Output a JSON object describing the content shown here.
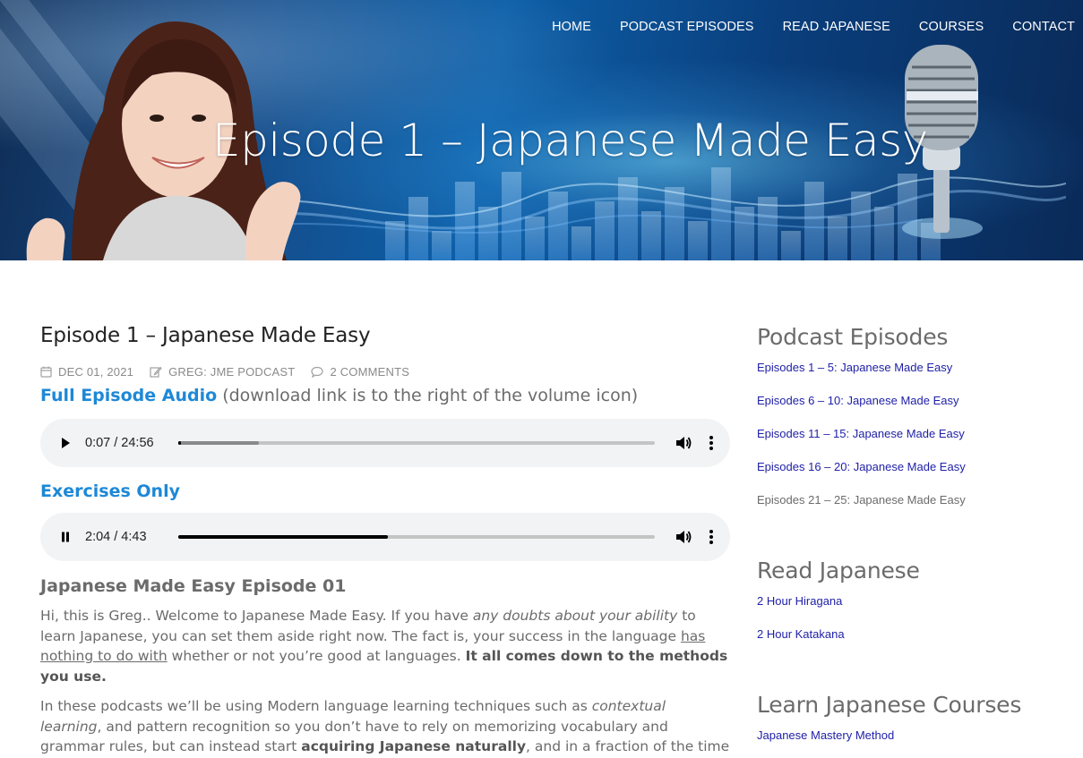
{
  "nav": {
    "items": [
      "HOME",
      "PODCAST EPISODES",
      "READ JAPANESE",
      "COURSES",
      "CONTACT"
    ]
  },
  "hero": {
    "title": "Episode 1 – Japanese Made Easy"
  },
  "post": {
    "title": "Episode 1 – Japanese Made Easy",
    "date": "DEC 01, 2021",
    "author": "GREG: JME PODCAST",
    "comments": "2 COMMENTS",
    "full_audio_heading": "Full Episode Audio",
    "full_audio_note": "(download link is to the right of the volume icon)",
    "exercises_heading": "Exercises Only",
    "episode_heading": "Japanese Made Easy Episode 01"
  },
  "players": [
    {
      "state": "paused",
      "time": "0:07 / 24:56",
      "progress": 0.005,
      "buffered": 0.17
    },
    {
      "state": "playing",
      "time": "2:04 / 4:43",
      "progress": 0.44,
      "buffered": 0.44
    }
  ],
  "paragraph1": {
    "t1": "Hi, this is Greg.. Welcome to Japanese Made Easy. If you have ",
    "i1": "any doubts about your ability",
    "t2": " to learn Japanese, you can set them aside right now. The fact is, your success in the language ",
    "u1": "has nothing to do with",
    "t3": " whether or not you’re good at languages. ",
    "b1": "It all comes down to the methods you use."
  },
  "paragraph2": {
    "t1": "In these podcasts we’ll be using Modern language learning techniques such as ",
    "i1": "contextual learning",
    "t2": ", and pattern recognition so you don’t have to rely on memorizing vocabulary and grammar rules, but can instead start ",
    "b1": "acquiring Japanese naturally",
    "t3": ", and in a fraction of the time it will otherwise take."
  },
  "sidebar": {
    "podcast_title": "Podcast Episodes",
    "podcast_links": [
      "Episodes 1 – 5: Japanese Made Easy",
      "Episodes 6 – 10: Japanese Made Easy",
      "Episodes 11 – 15: Japanese Made Easy",
      "Episodes 16 – 20: Japanese Made Easy",
      "Episodes 21 – 25: Japanese Made Easy"
    ],
    "read_title": "Read Japanese",
    "read_links": [
      "2 Hour Hiragana",
      "2 Hour Katakana"
    ],
    "courses_title": "Learn Japanese Courses",
    "courses_links": [
      "Japanese Mastery Method"
    ]
  },
  "colors": {
    "accent_blue": "#1e88d6",
    "link_blue": "#2121a8",
    "text_grey": "#6b6b6b"
  }
}
